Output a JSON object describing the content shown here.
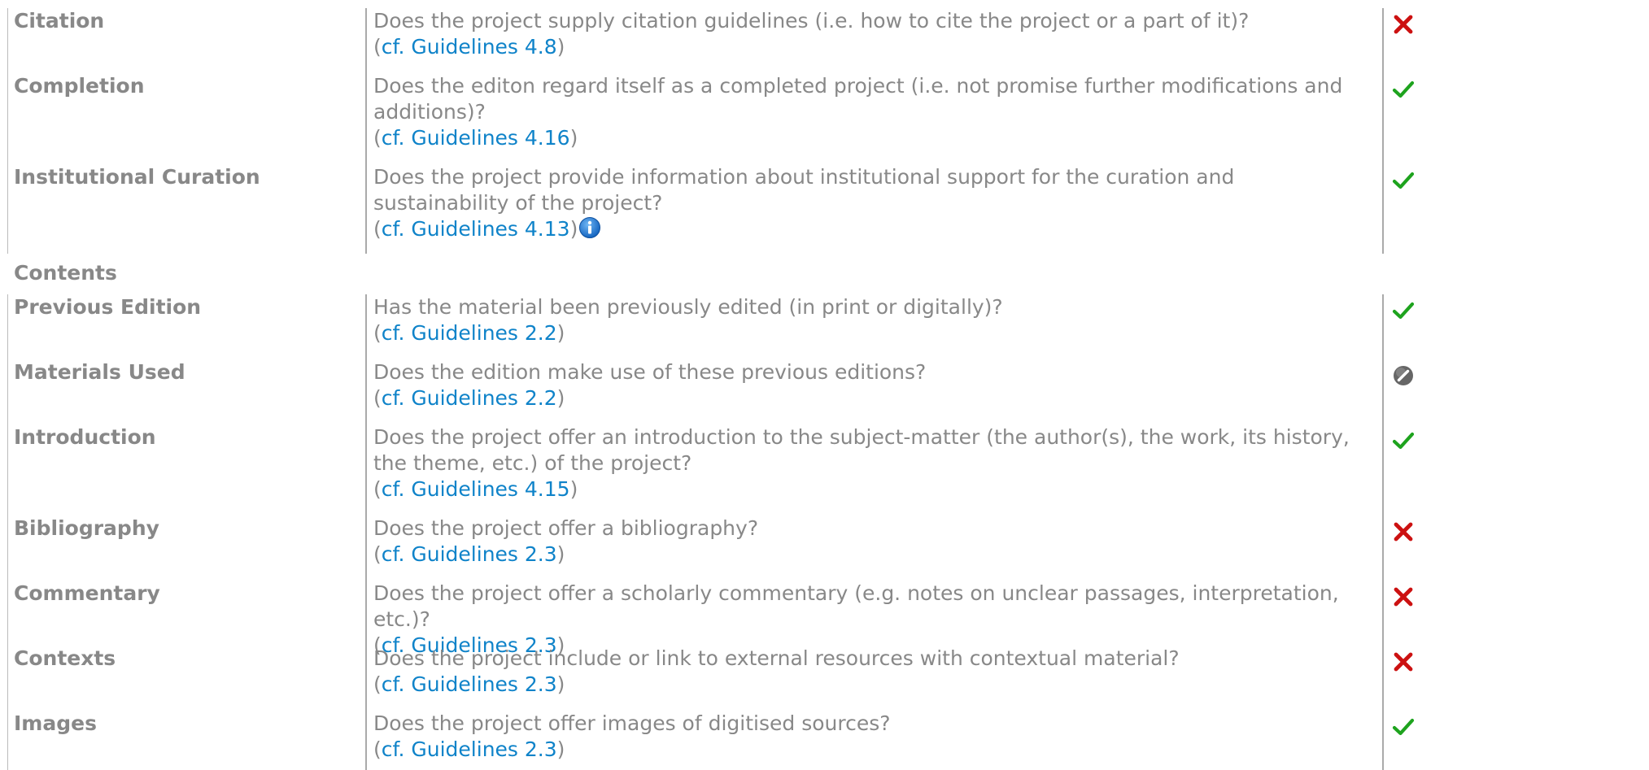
{
  "colors": {
    "text": "#888888",
    "link": "#0f83c9",
    "yes": "#1ea31e",
    "no": "#cc1111",
    "not_applicable": "#666666",
    "info": "#1e88e5"
  },
  "rows_top": [
    {
      "label": "Citation",
      "question": "Does the project supply citation guidelines (i.e. how to cite the project or a part of it)?",
      "ref": "cf. Guidelines 4.8",
      "status": "no",
      "status_icon": "cross-icon",
      "has_info": false
    },
    {
      "label": "Completion",
      "question": "Does the editon regard itself as a completed project (i.e. not promise further modifications and additions)?",
      "ref": "cf. Guidelines 4.16",
      "status": "yes",
      "status_icon": "check-icon",
      "has_info": false
    },
    {
      "label": "Institutional Curation",
      "question": "Does the project provide information about institutional support for the curation and sustainability of the project?",
      "ref": "cf. Guidelines 4.13",
      "status": "yes",
      "status_icon": "check-icon",
      "has_info": true,
      "info_icon": "info-icon"
    }
  ],
  "section": {
    "title": "Contents"
  },
  "rows_contents": [
    {
      "label": "Previous Edition",
      "question": "Has the material been previously edited (in print or digitally)?",
      "ref": "cf. Guidelines 2.2",
      "status": "yes",
      "status_icon": "check-icon"
    },
    {
      "label": "Materials Used",
      "question": "Does the edition make use of these previous editions?",
      "ref": "cf. Guidelines 2.2",
      "status": "not_applicable",
      "status_icon": "not-applicable-icon"
    },
    {
      "label": "Introduction",
      "question": "Does the project offer an introduction to the subject-matter (the author(s), the work, its history, the theme, etc.) of the project?",
      "ref": "cf. Guidelines 4.15",
      "status": "yes",
      "status_icon": "check-icon"
    },
    {
      "label": "Bibliography",
      "question": "Does the project offer a bibliography?",
      "ref": "cf. Guidelines 2.3",
      "status": "no",
      "status_icon": "cross-icon"
    },
    {
      "label": "Commentary",
      "question": "Does the project offer a scholarly commentary (e.g. notes on unclear passages, interpretation, etc.)?",
      "ref": "cf. Guidelines 2.3",
      "status": "no",
      "status_icon": "cross-icon"
    },
    {
      "label": "Contexts",
      "question": "Does the project include or link to external resources with contextual material?",
      "ref": "cf. Guidelines 2.3",
      "status": "no",
      "status_icon": "cross-icon"
    },
    {
      "label": "Images",
      "question": "Does the project offer images of digitised sources?",
      "ref": "cf. Guidelines 2.3",
      "status": "yes",
      "status_icon": "check-icon"
    }
  ]
}
